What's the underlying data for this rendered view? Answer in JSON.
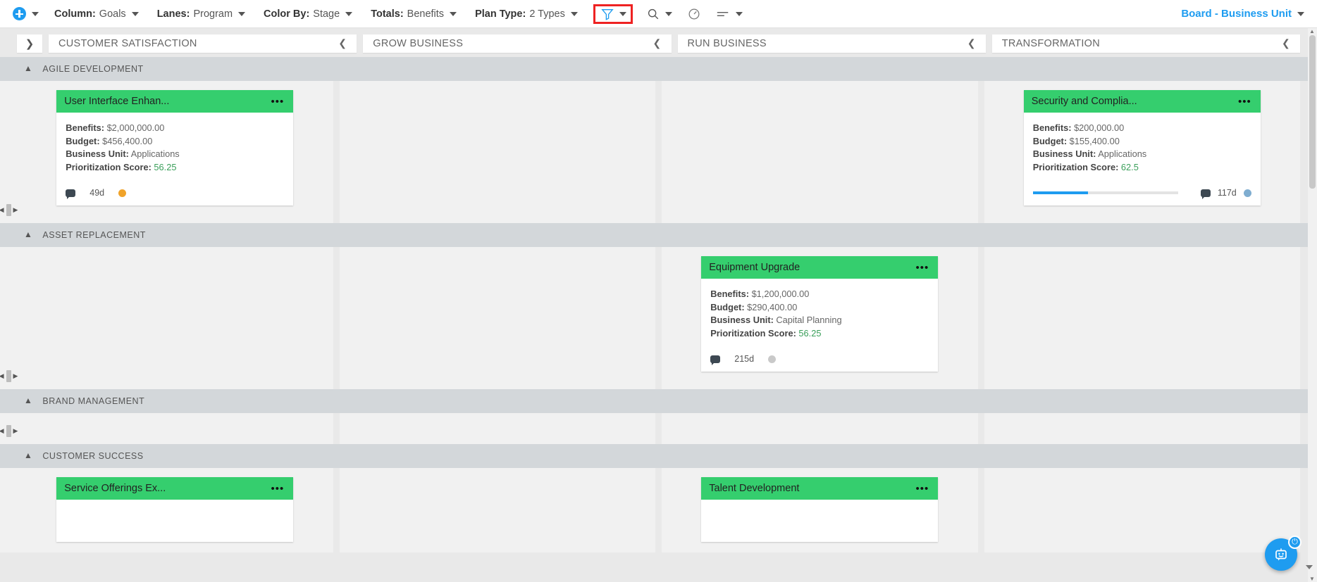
{
  "toolbar": {
    "add_icon": "plus-circle-icon",
    "controls": [
      {
        "label": "Column:",
        "value": "Goals"
      },
      {
        "label": "Lanes:",
        "value": "Program"
      },
      {
        "label": "Color By:",
        "value": "Stage"
      },
      {
        "label": "Totals:",
        "value": "Benefits"
      },
      {
        "label": "Plan Type:",
        "value": "2 Types"
      }
    ],
    "filter_icon": "funnel-icon",
    "search_icon": "search-icon",
    "gauge_icon": "gauge-icon",
    "sort_icon": "sort-lines-icon",
    "board_title": "Board - Business Unit",
    "highlight_color": "#ee2222",
    "accent_color": "#1e9cf0"
  },
  "board": {
    "lane_expand_icon": "chevron-right-icon",
    "columns": [
      {
        "title": "CUSTOMER SATISFACTION",
        "collapse_icon": "chevron-left-icon"
      },
      {
        "title": "GROW BUSINESS",
        "collapse_icon": "chevron-left-icon"
      },
      {
        "title": "RUN BUSINESS",
        "collapse_icon": "chevron-left-icon"
      },
      {
        "title": "TRANSFORMATION",
        "collapse_icon": "chevron-left-icon"
      }
    ],
    "card_header_color": "#35ce6e",
    "score_color": "#3a9f5a",
    "lanes": [
      {
        "title": "AGILE DEVELOPMENT",
        "collapse_icon": "chevron-up-icon",
        "cards": [
          {
            "column": 0,
            "title": "User Interface Enhan...",
            "menu_icon": "ellipsis-icon",
            "fields": [
              {
                "label": "Benefits:",
                "value": "$2,000,000.00"
              },
              {
                "label": "Budget:",
                "value": "$456,400.00"
              },
              {
                "label": "Business Unit:",
                "value": "Applications"
              },
              {
                "label": "Prioritization Score:",
                "value": "56.25",
                "accent": true
              }
            ],
            "progress": null,
            "comment_icon": "comment-icon",
            "duration": "49d",
            "status_color": "#f0a32a"
          },
          {
            "column": 3,
            "title": "Security and Complia...",
            "menu_icon": "ellipsis-icon",
            "fields": [
              {
                "label": "Benefits:",
                "value": "$200,000.00"
              },
              {
                "label": "Budget:",
                "value": "$155,400.00"
              },
              {
                "label": "Business Unit:",
                "value": "Applications"
              },
              {
                "label": "Prioritization Score:",
                "value": "62.5",
                "accent": true
              }
            ],
            "progress": 38,
            "comment_icon": "comment-icon",
            "duration": "117d",
            "status_color": "#7fadd0"
          }
        ]
      },
      {
        "title": "ASSET REPLACEMENT",
        "collapse_icon": "chevron-up-icon",
        "cards": [
          {
            "column": 2,
            "title": "Equipment Upgrade",
            "menu_icon": "ellipsis-icon",
            "fields": [
              {
                "label": "Benefits:",
                "value": "$1,200,000.00"
              },
              {
                "label": "Budget:",
                "value": "$290,400.00"
              },
              {
                "label": "Business Unit:",
                "value": "Capital Planning"
              },
              {
                "label": "Prioritization Score:",
                "value": "56.25",
                "accent": true
              }
            ],
            "progress": null,
            "comment_icon": "comment-icon",
            "duration": "215d",
            "status_color": "#c9c9c9"
          }
        ]
      },
      {
        "title": "BRAND MANAGEMENT",
        "collapse_icon": "chevron-up-icon",
        "cards": []
      },
      {
        "title": "CUSTOMER SUCCESS",
        "collapse_icon": "chevron-up-icon",
        "cards": [
          {
            "column": 0,
            "title": "Service Offerings Ex...",
            "menu_icon": "ellipsis-icon",
            "fields": [],
            "progress": null,
            "comment_icon": null,
            "duration": null,
            "status_color": null
          },
          {
            "column": 2,
            "title": "Talent Development",
            "menu_icon": "ellipsis-icon",
            "fields": [],
            "progress": null,
            "comment_icon": null,
            "duration": null,
            "status_color": null
          }
        ]
      }
    ]
  },
  "assistant": {
    "fab_icon": "chat-bot-icon",
    "power_icon": "power-icon",
    "collapse_icon": "caret-down-icon"
  }
}
